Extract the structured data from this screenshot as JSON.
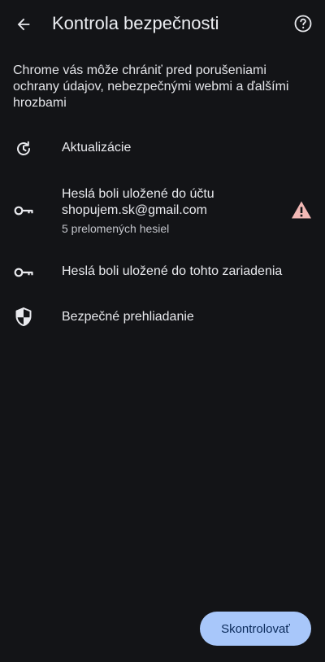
{
  "header": {
    "title": "Kontrola bezpečnosti",
    "back_icon": "arrow-back-icon",
    "help_icon": "help-circle-icon"
  },
  "description": "Chrome vás môže chrániť pred porušeniami ochrany údajov, nebezpečnými webmi a ďalšími hrozbami",
  "items": [
    {
      "icon": "update-history-icon",
      "label": "Aktualizácie"
    },
    {
      "icon": "key-icon",
      "label": "Heslá boli uložené do účtu shopujem.sk@gmail.com",
      "sub": "5 prelomených hesiel",
      "status_icon": "warning-triangle-icon"
    },
    {
      "icon": "key-icon",
      "label": "Heslá boli uložené do tohto zariadenia"
    },
    {
      "icon": "shield-icon",
      "label": "Bezpečné prehliadanie"
    }
  ],
  "button": {
    "label": "Skontrolovať"
  },
  "colors": {
    "background": "#131417",
    "text": "#e8e9ed",
    "button_bg": "#a8c7fa",
    "button_text": "#0a2a5a",
    "warning": "#f2b8b5"
  }
}
